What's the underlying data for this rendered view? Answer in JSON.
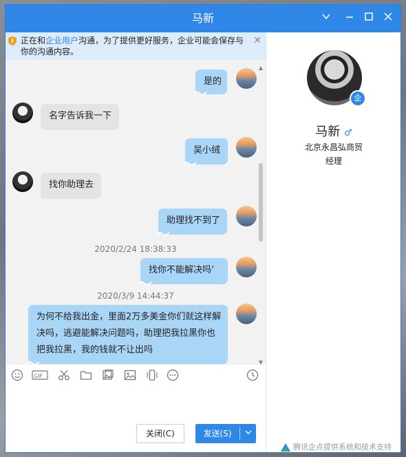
{
  "window": {
    "title": "马新",
    "controls": [
      "chevron-down-icon",
      "minimize-icon",
      "maximize-icon",
      "close-icon"
    ]
  },
  "notice": {
    "text_before": "正在和",
    "link": "企业用户",
    "text_after": "沟通，为了提供更好服务，企业可能会保存与你的沟通内容。"
  },
  "messages": [
    {
      "side": "me",
      "text": "是的"
    },
    {
      "side": "them",
      "text": "名字告诉我一下"
    },
    {
      "side": "me",
      "text": "吴小绒"
    },
    {
      "side": "them",
      "text": "找你助理去"
    },
    {
      "side": "me",
      "text": "助理找不到了"
    },
    {
      "side": "me",
      "text": "找你不能解决吗‘"
    },
    {
      "side": "me",
      "line1": "为何不给我出金，里面2万多美金你们就这样解",
      "line2": "决吗，逃避能解决问题吗，助理把我拉黑你也",
      "line3": "把我拉黑，我的钱就不让出吗"
    }
  ],
  "timestamps": [
    "2020/2/24 18:38:33",
    "2020/3/9 14:44:37"
  ],
  "toolbar": [
    "emoji-icon",
    "gif-icon",
    "scissors-icon",
    "folder-icon",
    "image-folder-icon",
    "picture-icon",
    "vibrate-icon",
    "more-icon",
    "history-clock-icon"
  ],
  "buttons": {
    "close": "关闭(C)",
    "send": "发送(S)"
  },
  "profile": {
    "name": "马新",
    "gender_symbol": "♂",
    "badge": "企",
    "company": "北京永昌弘商贸",
    "title": "经理"
  },
  "footer": "腾讯企点提供系统和技术支持",
  "colors": {
    "accent": "#2f87e8",
    "my_bubble": "#a9d5f7",
    "their_bubble": "#e4e4e4"
  }
}
